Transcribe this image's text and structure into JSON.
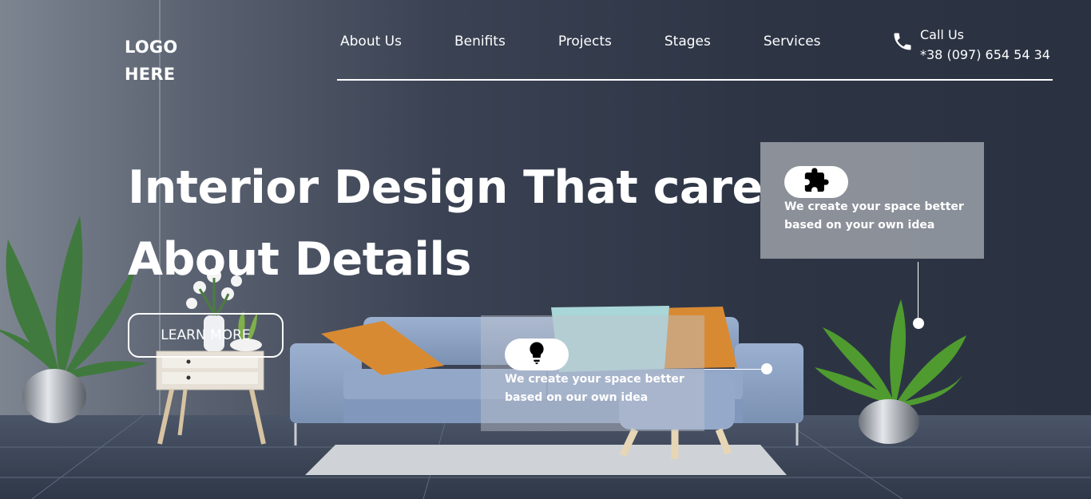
{
  "header": {
    "logo_line1": "LOGO",
    "logo_line2": "HERE",
    "nav": [
      {
        "label": "About Us"
      },
      {
        "label": "Benifits"
      },
      {
        "label": "Projects"
      },
      {
        "label": "Stages"
      },
      {
        "label": "Services"
      }
    ],
    "call_label": "Call Us",
    "phone": "*38 (097) 654 54 34",
    "phone_icon": "phone-icon"
  },
  "hero": {
    "headline_line1": "Interior Design That care",
    "headline_line2": "About Details",
    "cta_label": "LEARN MORE"
  },
  "cards": [
    {
      "icon": "puzzle-icon",
      "text_line1": "We create your space better",
      "text_line2": "based on your own idea"
    },
    {
      "icon": "lightbulb-icon",
      "text_line1": "We create your space better",
      "text_line2": "based on our own idea"
    }
  ],
  "colors": {
    "wall_left": "#7d8591",
    "wall_right": "#2a3242",
    "sofa": "#8ea4c6",
    "pillow_orange": "#d88a32",
    "pillow_mint": "#a9d6d8",
    "floor": "#3a4558",
    "text": "#ffffff"
  }
}
